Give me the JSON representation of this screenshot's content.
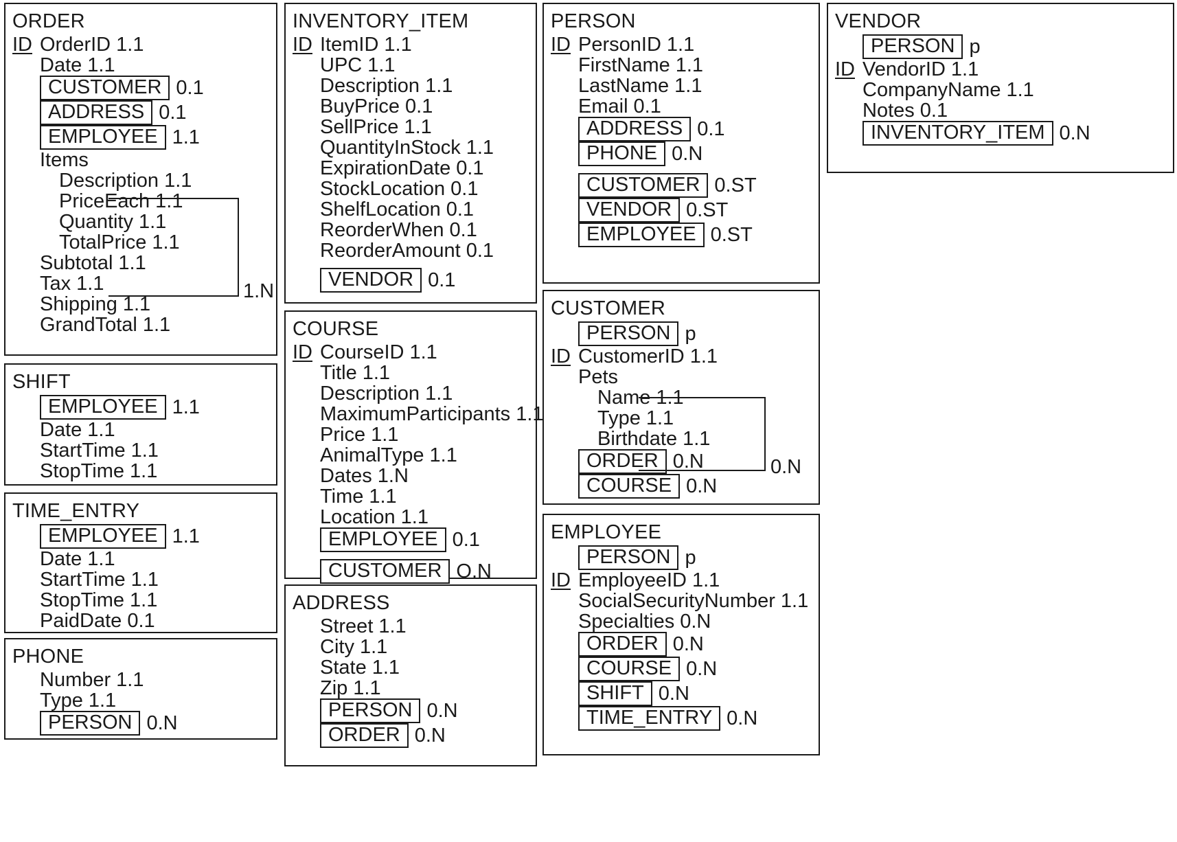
{
  "diagram": {
    "title": "Data Model Entity Diagram",
    "notation": {
      "id_marker": "ID",
      "supertype_marker": "p"
    }
  },
  "entities": [
    {
      "name": "ORDER",
      "rows": [
        {
          "id": "ID",
          "indent": 0,
          "text": "OrderID",
          "card": "1.1"
        },
        {
          "id": "",
          "indent": 1,
          "text": "Date",
          "card": "1.1"
        },
        {
          "id": "",
          "indent": 1,
          "rel": "CUSTOMER",
          "card": "0.1"
        },
        {
          "id": "",
          "indent": 1,
          "rel": "ADDRESS",
          "card": "0.1"
        },
        {
          "id": "",
          "indent": 1,
          "rel": "EMPLOYEE",
          "card": "1.1"
        },
        {
          "id": "",
          "indent": 1,
          "text": "Items",
          "card": ""
        },
        {
          "id": "",
          "indent": 2,
          "text": "Description",
          "card": "1.1"
        },
        {
          "id": "",
          "indent": 2,
          "text": "PriceEach",
          "card": "1.1"
        },
        {
          "id": "",
          "indent": 2,
          "text": "Quantity",
          "card": "1.1"
        },
        {
          "id": "",
          "indent": 2,
          "text": "TotalPrice",
          "card": "1.1"
        },
        {
          "id": "",
          "indent": 1,
          "text": "Subtotal",
          "card": "1.1"
        },
        {
          "id": "",
          "indent": 1,
          "text": "Tax",
          "card": "1.1"
        },
        {
          "id": "",
          "indent": 1,
          "text": "Shipping",
          "card": "1.1"
        },
        {
          "id": "",
          "indent": 1,
          "text": "GrandTotal",
          "card": "1.1"
        }
      ],
      "group_card": "1.N"
    },
    {
      "name": "SHIFT",
      "rows": [
        {
          "id": "",
          "indent": 1,
          "rel": "EMPLOYEE",
          "card": "1.1"
        },
        {
          "id": "",
          "indent": 1,
          "text": "Date ",
          "card": "1.1"
        },
        {
          "id": "",
          "indent": 1,
          "text": "StartTime",
          "card": "1.1"
        },
        {
          "id": "",
          "indent": 1,
          "text": "StopTime",
          "card": "1.1"
        }
      ]
    },
    {
      "name": "TIME_ENTRY",
      "rows": [
        {
          "id": "",
          "indent": 1,
          "rel": "EMPLOYEE",
          "card": "1.1"
        },
        {
          "id": "",
          "indent": 1,
          "text": "Date",
          "card": "1.1"
        },
        {
          "id": "",
          "indent": 1,
          "text": "StartTime",
          "card": "1.1"
        },
        {
          "id": "",
          "indent": 1,
          "text": "StopTime",
          "card": "1.1"
        },
        {
          "id": "",
          "indent": 1,
          "text": "PaidDate",
          "card": "0.1"
        }
      ]
    },
    {
      "name": "PHONE",
      "rows": [
        {
          "id": "",
          "indent": 1,
          "text": "Number",
          "card": "1.1"
        },
        {
          "id": "",
          "indent": 1,
          "text": "Type",
          "card": "1.1"
        },
        {
          "id": "",
          "indent": 1,
          "rel": "PERSON",
          "card": "0.N"
        }
      ]
    },
    {
      "name": "INVENTORY_ITEM",
      "rows": [
        {
          "id": "ID",
          "indent": 0,
          "text": "ItemID",
          "card": "1.1"
        },
        {
          "id": "",
          "indent": 1,
          "text": "UPC",
          "card": "1.1"
        },
        {
          "id": "",
          "indent": 1,
          "text": "Description",
          "card": "1.1"
        },
        {
          "id": "",
          "indent": 1,
          "text": "BuyPrice",
          "card": "0.1"
        },
        {
          "id": "",
          "indent": 1,
          "text": "SellPrice",
          "card": "1.1"
        },
        {
          "id": "",
          "indent": 1,
          "text": "QuantityInStock",
          "card": "1.1"
        },
        {
          "id": "",
          "indent": 1,
          "text": "ExpirationDate",
          "card": "0.1"
        },
        {
          "id": "",
          "indent": 1,
          "text": "StockLocation",
          "card": "0.1"
        },
        {
          "id": "",
          "indent": 1,
          "text": "ShelfLocation",
          "card": "0.1"
        },
        {
          "id": "",
          "indent": 1,
          "text": "ReorderWhen",
          "card": "0.1"
        },
        {
          "id": "",
          "indent": 1,
          "text": "ReorderAmount",
          "card": "0.1"
        },
        {
          "id": "",
          "indent": 1,
          "rel": "VENDOR",
          "card": "0.1",
          "gap": true
        }
      ]
    },
    {
      "name": "COURSE",
      "rows": [
        {
          "id": "ID",
          "indent": 0,
          "text": "CourseID",
          "card": "1.1"
        },
        {
          "id": "",
          "indent": 1,
          "text": "Title",
          "card": "1.1"
        },
        {
          "id": "",
          "indent": 1,
          "text": "Description",
          "card": "1.1"
        },
        {
          "id": "",
          "indent": 1,
          "text": "MaximumParticipants",
          "card": "1.1"
        },
        {
          "id": "",
          "indent": 1,
          "text": "Price",
          "card": "1.1"
        },
        {
          "id": "",
          "indent": 1,
          "text": "AnimalType",
          "card": "1.1"
        },
        {
          "id": "",
          "indent": 1,
          "text": "Dates",
          "card": "1.N"
        },
        {
          "id": "",
          "indent": 1,
          "text": "Time",
          "card": "1.1"
        },
        {
          "id": "",
          "indent": 1,
          "text": "Location",
          "card": "1.1"
        },
        {
          "id": "",
          "indent": 1,
          "rel": "EMPLOYEE",
          "card": "0.1"
        },
        {
          "id": "",
          "indent": 1,
          "rel": "CUSTOMER",
          "card": "O.N",
          "gap": true
        }
      ]
    },
    {
      "name": "ADDRESS",
      "rows": [
        {
          "id": "",
          "indent": 1,
          "text": "Street",
          "card": "1.1"
        },
        {
          "id": "",
          "indent": 1,
          "text": "City",
          "card": "1.1"
        },
        {
          "id": "",
          "indent": 1,
          "text": "State",
          "card": "1.1"
        },
        {
          "id": "",
          "indent": 1,
          "text": "Zip",
          "card": "1.1"
        },
        {
          "id": "",
          "indent": 1,
          "rel": "PERSON",
          "card": "0.N"
        },
        {
          "id": "",
          "indent": 1,
          "rel": "ORDER",
          "card": "0.N"
        }
      ]
    },
    {
      "name": "PERSON",
      "rows": [
        {
          "id": "ID",
          "indent": 0,
          "text": "PersonID",
          "card": "1.1"
        },
        {
          "id": "",
          "indent": 1,
          "text": "FirstName",
          "card": "1.1"
        },
        {
          "id": "",
          "indent": 1,
          "text": "LastName",
          "card": "1.1"
        },
        {
          "id": "",
          "indent": 1,
          "text": "Email",
          "card": "0.1"
        },
        {
          "id": "",
          "indent": 1,
          "rel": "ADDRESS",
          "card": "0.1"
        },
        {
          "id": "",
          "indent": 1,
          "rel": "PHONE",
          "card": "0.N"
        },
        {
          "id": "",
          "indent": 1,
          "rel": "CUSTOMER",
          "card": "0.ST",
          "gap": true
        },
        {
          "id": "",
          "indent": 1,
          "rel": "VENDOR",
          "card": "0.ST"
        },
        {
          "id": "",
          "indent": 1,
          "rel": "EMPLOYEE",
          "card": "0.ST"
        }
      ]
    },
    {
      "name": "CUSTOMER",
      "rows": [
        {
          "id": "",
          "indent": 1,
          "rel": "PERSON",
          "card": "p"
        },
        {
          "id": "ID",
          "indent": 0,
          "text": "CustomerID",
          "card": "1.1"
        },
        {
          "id": "",
          "indent": 1,
          "text": "Pets",
          "card": ""
        },
        {
          "id": "",
          "indent": 2,
          "text": "Name",
          "card": "1.1"
        },
        {
          "id": "",
          "indent": 2,
          "text": "Type",
          "card": "1.1"
        },
        {
          "id": "",
          "indent": 2,
          "text": "Birthdate",
          "card": "1.1"
        },
        {
          "id": "",
          "indent": 1,
          "rel": "ORDER",
          "card": "0.N"
        },
        {
          "id": "",
          "indent": 1,
          "rel": "COURSE",
          "card": "0.N"
        }
      ],
      "group_card": "0.N"
    },
    {
      "name": "EMPLOYEE",
      "rows": [
        {
          "id": "",
          "indent": 1,
          "rel": "PERSON",
          "card": "p"
        },
        {
          "id": "ID",
          "indent": 0,
          "text": "EmployeeID",
          "card": "1.1"
        },
        {
          "id": "",
          "indent": 1,
          "text": "SocialSecurityNumber",
          "card": "1.1"
        },
        {
          "id": "",
          "indent": 1,
          "text": "Specialties",
          "card": "0.N"
        },
        {
          "id": "",
          "indent": 1,
          "rel": "ORDER",
          "card": "0.N"
        },
        {
          "id": "",
          "indent": 1,
          "rel": "COURSE",
          "card": "0.N"
        },
        {
          "id": "",
          "indent": 1,
          "rel": "SHIFT",
          "card": "0.N"
        },
        {
          "id": "",
          "indent": 1,
          "rel": "TIME_ENTRY",
          "card": "0.N"
        }
      ]
    },
    {
      "name": "VENDOR",
      "rows": [
        {
          "id": "",
          "indent": 1,
          "rel": "PERSON",
          "card": "p"
        },
        {
          "id": "ID",
          "indent": 0,
          "text": "VendorID",
          "card": "1.1"
        },
        {
          "id": "",
          "indent": 1,
          "text": "CompanyName",
          "card": "1.1"
        },
        {
          "id": "",
          "indent": 1,
          "text": "Notes",
          "card": "0.1"
        },
        {
          "id": "",
          "indent": 1,
          "rel": "INVENTORY_ITEM",
          "card": "0.N"
        }
      ]
    }
  ]
}
